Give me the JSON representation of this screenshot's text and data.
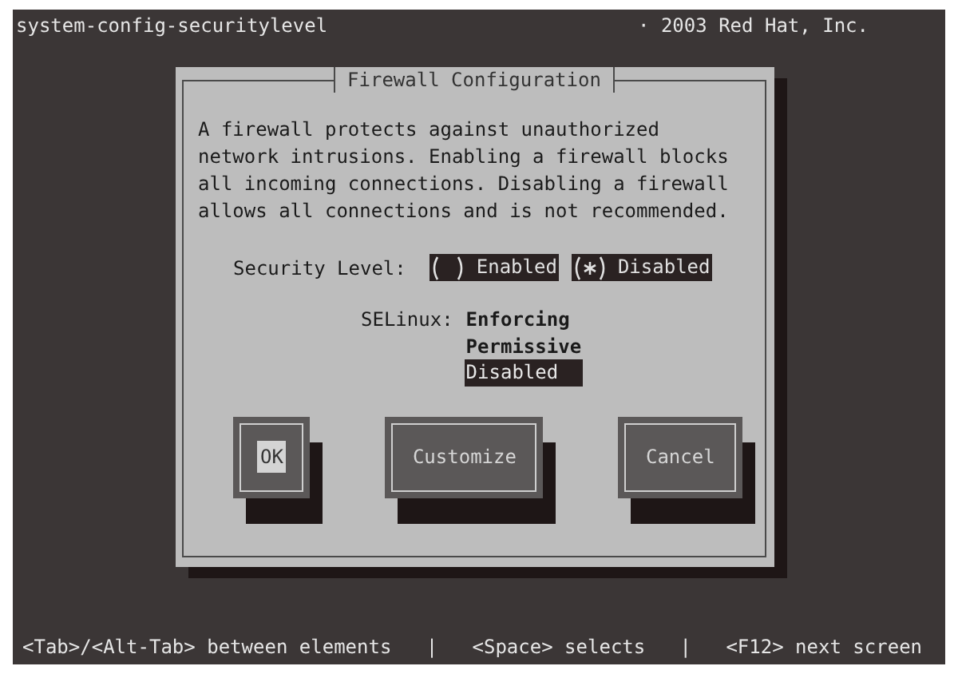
{
  "header": {
    "title": "system-config-securitylevel",
    "copyright": "· 2003 Red Hat, Inc."
  },
  "dialog": {
    "title": "Firewall Configuration",
    "description": "A firewall protects against unauthorized\nnetwork intrusions. Enabling a firewall blocks\nall incoming connections. Disabling a firewall\nallows all connections and is not recommended.",
    "security_level": {
      "label": "Security Level:",
      "options": [
        {
          "label": "Enabled",
          "checked": false
        },
        {
          "label": "Disabled",
          "checked": true
        }
      ]
    },
    "selinux": {
      "label": "SELinux:",
      "options": [
        {
          "label": "Enforcing",
          "selected": false
        },
        {
          "label": "Permissive",
          "selected": false
        },
        {
          "label": "Disabled",
          "selected": true
        }
      ]
    },
    "buttons": [
      {
        "label": "OK",
        "focused": true
      },
      {
        "label": "Customize",
        "focused": false
      },
      {
        "label": "Cancel",
        "focused": false
      }
    ]
  },
  "status_bar": {
    "text": "<Tab>/<Alt-Tab> between elements   |   <Space> selects   |   <F12> next screen"
  }
}
